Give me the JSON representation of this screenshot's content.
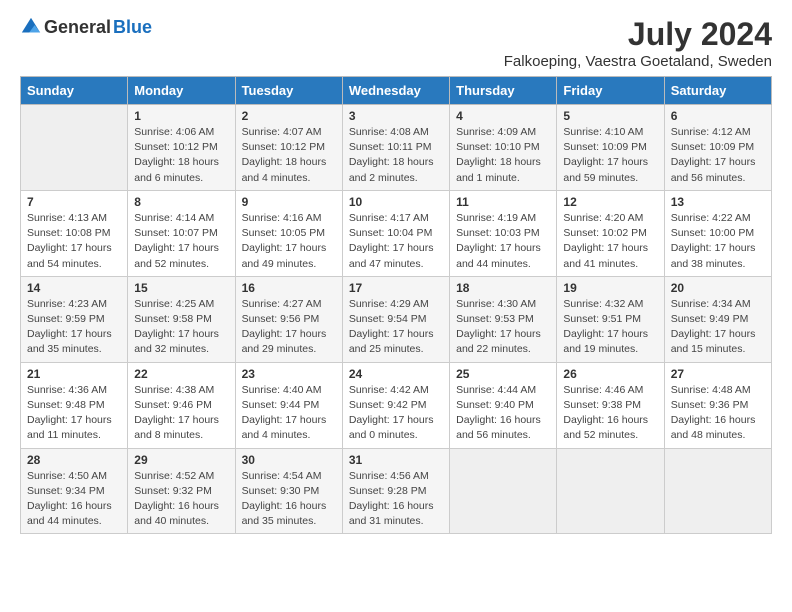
{
  "logo": {
    "general": "General",
    "blue": "Blue"
  },
  "title": "July 2024",
  "location": "Falkoeping, Vaestra Goetaland, Sweden",
  "days_of_week": [
    "Sunday",
    "Monday",
    "Tuesday",
    "Wednesday",
    "Thursday",
    "Friday",
    "Saturday"
  ],
  "weeks": [
    [
      {
        "day": "",
        "info": ""
      },
      {
        "day": "1",
        "info": "Sunrise: 4:06 AM\nSunset: 10:12 PM\nDaylight: 18 hours\nand 6 minutes."
      },
      {
        "day": "2",
        "info": "Sunrise: 4:07 AM\nSunset: 10:12 PM\nDaylight: 18 hours\nand 4 minutes."
      },
      {
        "day": "3",
        "info": "Sunrise: 4:08 AM\nSunset: 10:11 PM\nDaylight: 18 hours\nand 2 minutes."
      },
      {
        "day": "4",
        "info": "Sunrise: 4:09 AM\nSunset: 10:10 PM\nDaylight: 18 hours\nand 1 minute."
      },
      {
        "day": "5",
        "info": "Sunrise: 4:10 AM\nSunset: 10:09 PM\nDaylight: 17 hours\nand 59 minutes."
      },
      {
        "day": "6",
        "info": "Sunrise: 4:12 AM\nSunset: 10:09 PM\nDaylight: 17 hours\nand 56 minutes."
      }
    ],
    [
      {
        "day": "7",
        "info": "Sunrise: 4:13 AM\nSunset: 10:08 PM\nDaylight: 17 hours\nand 54 minutes."
      },
      {
        "day": "8",
        "info": "Sunrise: 4:14 AM\nSunset: 10:07 PM\nDaylight: 17 hours\nand 52 minutes."
      },
      {
        "day": "9",
        "info": "Sunrise: 4:16 AM\nSunset: 10:05 PM\nDaylight: 17 hours\nand 49 minutes."
      },
      {
        "day": "10",
        "info": "Sunrise: 4:17 AM\nSunset: 10:04 PM\nDaylight: 17 hours\nand 47 minutes."
      },
      {
        "day": "11",
        "info": "Sunrise: 4:19 AM\nSunset: 10:03 PM\nDaylight: 17 hours\nand 44 minutes."
      },
      {
        "day": "12",
        "info": "Sunrise: 4:20 AM\nSunset: 10:02 PM\nDaylight: 17 hours\nand 41 minutes."
      },
      {
        "day": "13",
        "info": "Sunrise: 4:22 AM\nSunset: 10:00 PM\nDaylight: 17 hours\nand 38 minutes."
      }
    ],
    [
      {
        "day": "14",
        "info": "Sunrise: 4:23 AM\nSunset: 9:59 PM\nDaylight: 17 hours\nand 35 minutes."
      },
      {
        "day": "15",
        "info": "Sunrise: 4:25 AM\nSunset: 9:58 PM\nDaylight: 17 hours\nand 32 minutes."
      },
      {
        "day": "16",
        "info": "Sunrise: 4:27 AM\nSunset: 9:56 PM\nDaylight: 17 hours\nand 29 minutes."
      },
      {
        "day": "17",
        "info": "Sunrise: 4:29 AM\nSunset: 9:54 PM\nDaylight: 17 hours\nand 25 minutes."
      },
      {
        "day": "18",
        "info": "Sunrise: 4:30 AM\nSunset: 9:53 PM\nDaylight: 17 hours\nand 22 minutes."
      },
      {
        "day": "19",
        "info": "Sunrise: 4:32 AM\nSunset: 9:51 PM\nDaylight: 17 hours\nand 19 minutes."
      },
      {
        "day": "20",
        "info": "Sunrise: 4:34 AM\nSunset: 9:49 PM\nDaylight: 17 hours\nand 15 minutes."
      }
    ],
    [
      {
        "day": "21",
        "info": "Sunrise: 4:36 AM\nSunset: 9:48 PM\nDaylight: 17 hours\nand 11 minutes."
      },
      {
        "day": "22",
        "info": "Sunrise: 4:38 AM\nSunset: 9:46 PM\nDaylight: 17 hours\nand 8 minutes."
      },
      {
        "day": "23",
        "info": "Sunrise: 4:40 AM\nSunset: 9:44 PM\nDaylight: 17 hours\nand 4 minutes."
      },
      {
        "day": "24",
        "info": "Sunrise: 4:42 AM\nSunset: 9:42 PM\nDaylight: 17 hours\nand 0 minutes."
      },
      {
        "day": "25",
        "info": "Sunrise: 4:44 AM\nSunset: 9:40 PM\nDaylight: 16 hours\nand 56 minutes."
      },
      {
        "day": "26",
        "info": "Sunrise: 4:46 AM\nSunset: 9:38 PM\nDaylight: 16 hours\nand 52 minutes."
      },
      {
        "day": "27",
        "info": "Sunrise: 4:48 AM\nSunset: 9:36 PM\nDaylight: 16 hours\nand 48 minutes."
      }
    ],
    [
      {
        "day": "28",
        "info": "Sunrise: 4:50 AM\nSunset: 9:34 PM\nDaylight: 16 hours\nand 44 minutes."
      },
      {
        "day": "29",
        "info": "Sunrise: 4:52 AM\nSunset: 9:32 PM\nDaylight: 16 hours\nand 40 minutes."
      },
      {
        "day": "30",
        "info": "Sunrise: 4:54 AM\nSunset: 9:30 PM\nDaylight: 16 hours\nand 35 minutes."
      },
      {
        "day": "31",
        "info": "Sunrise: 4:56 AM\nSunset: 9:28 PM\nDaylight: 16 hours\nand 31 minutes."
      },
      {
        "day": "",
        "info": ""
      },
      {
        "day": "",
        "info": ""
      },
      {
        "day": "",
        "info": ""
      }
    ]
  ]
}
